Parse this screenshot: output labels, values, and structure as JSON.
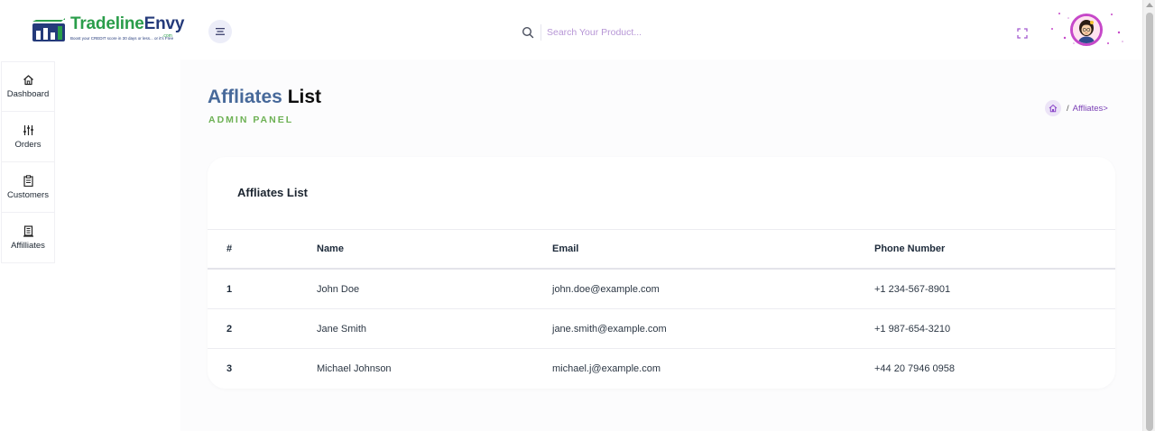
{
  "brand": {
    "name_part1": "Tradeline",
    "name_part2": "Envy",
    "domain_suffix": ".com",
    "tagline": "Boost your CREDIT score in 30 days or less... or it's Free",
    "colors": {
      "green": "#2a9d4a",
      "navy": "#243a7a"
    }
  },
  "header": {
    "menu_icon": "hamburger-icon",
    "search": {
      "placeholder": "Search Your Product...",
      "value": ""
    },
    "fullscreen_icon": "fullscreen-icon"
  },
  "sidebar": {
    "items": [
      {
        "label": "Dashboard",
        "icon": "home-icon"
      },
      {
        "label": "Orders",
        "icon": "sliders-icon"
      },
      {
        "label": "Customers",
        "icon": "clipboard-icon"
      },
      {
        "label": "Affilliates",
        "icon": "building-icon"
      }
    ]
  },
  "page": {
    "title_part1": "Affliates",
    "title_part2": "List",
    "subtitle": "ADMIN PANEL",
    "breadcrumb": {
      "separator": "/",
      "current": "Affliates>"
    }
  },
  "card": {
    "title": "Affliates List",
    "table": {
      "columns": [
        "#",
        "Name",
        "Email",
        "Phone Number"
      ],
      "rows": [
        [
          "1",
          "John Doe",
          "john.doe@example.com",
          "+1 234-567-8901"
        ],
        [
          "2",
          "Jane Smith",
          "jane.smith@example.com",
          "+1 987-654-3210"
        ],
        [
          "3",
          "Michael Johnson",
          "michael.j@example.com",
          "+44 20 7946 0958"
        ]
      ]
    }
  },
  "colors": {
    "title_blue": "#47699a",
    "subtitle_green": "#6db154",
    "accent_purple": "#7a3fb5",
    "avatar_ring": "#c648c9"
  }
}
